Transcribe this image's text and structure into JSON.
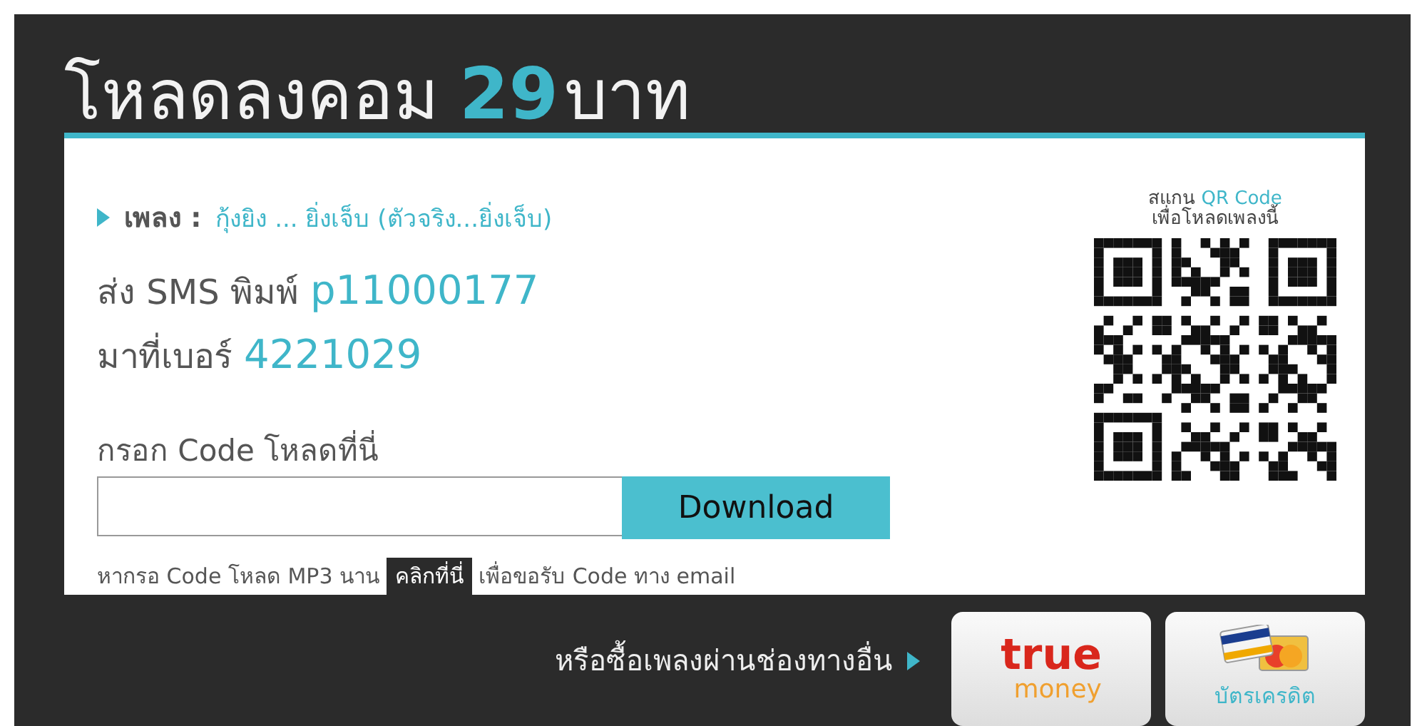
{
  "header": {
    "title_prefix": "โหลดลงคอม",
    "price": "29",
    "title_suffix": "บาท"
  },
  "song": {
    "label": "เพลง :",
    "name": "กุ้งยิง ... ยิ่งเจ็บ (ตัวจริง...ยิ่งเจ็บ)"
  },
  "sms": [
    {
      "label": "ส่ง SMS พิมพ์",
      "value": "p11000177"
    },
    {
      "label": "มาที่เบอร์",
      "value": "4221029"
    }
  ],
  "code_form": {
    "label": "กรอก Code โหลดที่นี่",
    "button": "Download"
  },
  "note": {
    "before": "หากรอ Code โหลด MP3 นาน",
    "link": "คลิกที่นี่",
    "after": "เพื่อขอรับ Code ทาง email"
  },
  "qr": {
    "caption_prefix": "สแกน",
    "caption_highlight": "QR Code",
    "caption_line2": "เพื่อโหลดเพลงนี้"
  },
  "footer": {
    "text": "หรือซื้อเพลงผ่านช่องทางอื่น",
    "options": [
      {
        "kind": "wallet",
        "top": "true",
        "bottom": "money"
      },
      {
        "kind": "card",
        "label": "บัตรเครดิต"
      }
    ]
  }
}
